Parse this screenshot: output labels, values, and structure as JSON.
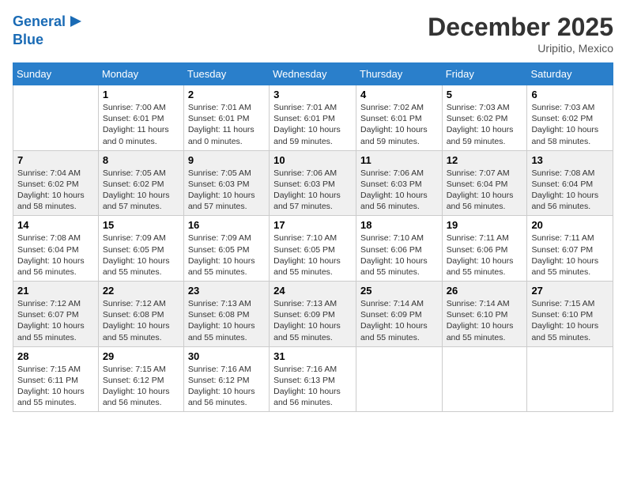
{
  "logo": {
    "line1": "General",
    "line2": "Blue"
  },
  "title": "December 2025",
  "location": "Uripitio, Mexico",
  "days_of_week": [
    "Sunday",
    "Monday",
    "Tuesday",
    "Wednesday",
    "Thursday",
    "Friday",
    "Saturday"
  ],
  "weeks": [
    [
      {
        "day": null,
        "info": null
      },
      {
        "day": "1",
        "sunrise": "7:00 AM",
        "sunset": "6:01 PM",
        "daylight": "11 hours and 0 minutes."
      },
      {
        "day": "2",
        "sunrise": "7:01 AM",
        "sunset": "6:01 PM",
        "daylight": "11 hours and 0 minutes."
      },
      {
        "day": "3",
        "sunrise": "7:01 AM",
        "sunset": "6:01 PM",
        "daylight": "10 hours and 59 minutes."
      },
      {
        "day": "4",
        "sunrise": "7:02 AM",
        "sunset": "6:01 PM",
        "daylight": "10 hours and 59 minutes."
      },
      {
        "day": "5",
        "sunrise": "7:03 AM",
        "sunset": "6:02 PM",
        "daylight": "10 hours and 59 minutes."
      },
      {
        "day": "6",
        "sunrise": "7:03 AM",
        "sunset": "6:02 PM",
        "daylight": "10 hours and 58 minutes."
      }
    ],
    [
      {
        "day": "7",
        "sunrise": "7:04 AM",
        "sunset": "6:02 PM",
        "daylight": "10 hours and 58 minutes."
      },
      {
        "day": "8",
        "sunrise": "7:05 AM",
        "sunset": "6:02 PM",
        "daylight": "10 hours and 57 minutes."
      },
      {
        "day": "9",
        "sunrise": "7:05 AM",
        "sunset": "6:03 PM",
        "daylight": "10 hours and 57 minutes."
      },
      {
        "day": "10",
        "sunrise": "7:06 AM",
        "sunset": "6:03 PM",
        "daylight": "10 hours and 57 minutes."
      },
      {
        "day": "11",
        "sunrise": "7:06 AM",
        "sunset": "6:03 PM",
        "daylight": "10 hours and 56 minutes."
      },
      {
        "day": "12",
        "sunrise": "7:07 AM",
        "sunset": "6:04 PM",
        "daylight": "10 hours and 56 minutes."
      },
      {
        "day": "13",
        "sunrise": "7:08 AM",
        "sunset": "6:04 PM",
        "daylight": "10 hours and 56 minutes."
      }
    ],
    [
      {
        "day": "14",
        "sunrise": "7:08 AM",
        "sunset": "6:04 PM",
        "daylight": "10 hours and 56 minutes."
      },
      {
        "day": "15",
        "sunrise": "7:09 AM",
        "sunset": "6:05 PM",
        "daylight": "10 hours and 55 minutes."
      },
      {
        "day": "16",
        "sunrise": "7:09 AM",
        "sunset": "6:05 PM",
        "daylight": "10 hours and 55 minutes."
      },
      {
        "day": "17",
        "sunrise": "7:10 AM",
        "sunset": "6:05 PM",
        "daylight": "10 hours and 55 minutes."
      },
      {
        "day": "18",
        "sunrise": "7:10 AM",
        "sunset": "6:06 PM",
        "daylight": "10 hours and 55 minutes."
      },
      {
        "day": "19",
        "sunrise": "7:11 AM",
        "sunset": "6:06 PM",
        "daylight": "10 hours and 55 minutes."
      },
      {
        "day": "20",
        "sunrise": "7:11 AM",
        "sunset": "6:07 PM",
        "daylight": "10 hours and 55 minutes."
      }
    ],
    [
      {
        "day": "21",
        "sunrise": "7:12 AM",
        "sunset": "6:07 PM",
        "daylight": "10 hours and 55 minutes."
      },
      {
        "day": "22",
        "sunrise": "7:12 AM",
        "sunset": "6:08 PM",
        "daylight": "10 hours and 55 minutes."
      },
      {
        "day": "23",
        "sunrise": "7:13 AM",
        "sunset": "6:08 PM",
        "daylight": "10 hours and 55 minutes."
      },
      {
        "day": "24",
        "sunrise": "7:13 AM",
        "sunset": "6:09 PM",
        "daylight": "10 hours and 55 minutes."
      },
      {
        "day": "25",
        "sunrise": "7:14 AM",
        "sunset": "6:09 PM",
        "daylight": "10 hours and 55 minutes."
      },
      {
        "day": "26",
        "sunrise": "7:14 AM",
        "sunset": "6:10 PM",
        "daylight": "10 hours and 55 minutes."
      },
      {
        "day": "27",
        "sunrise": "7:15 AM",
        "sunset": "6:10 PM",
        "daylight": "10 hours and 55 minutes."
      }
    ],
    [
      {
        "day": "28",
        "sunrise": "7:15 AM",
        "sunset": "6:11 PM",
        "daylight": "10 hours and 55 minutes."
      },
      {
        "day": "29",
        "sunrise": "7:15 AM",
        "sunset": "6:12 PM",
        "daylight": "10 hours and 56 minutes."
      },
      {
        "day": "30",
        "sunrise": "7:16 AM",
        "sunset": "6:12 PM",
        "daylight": "10 hours and 56 minutes."
      },
      {
        "day": "31",
        "sunrise": "7:16 AM",
        "sunset": "6:13 PM",
        "daylight": "10 hours and 56 minutes."
      },
      {
        "day": null,
        "info": null
      },
      {
        "day": null,
        "info": null
      },
      {
        "day": null,
        "info": null
      }
    ]
  ],
  "labels": {
    "sunrise_prefix": "Sunrise: ",
    "sunset_prefix": "Sunset: ",
    "daylight_prefix": "Daylight: "
  }
}
